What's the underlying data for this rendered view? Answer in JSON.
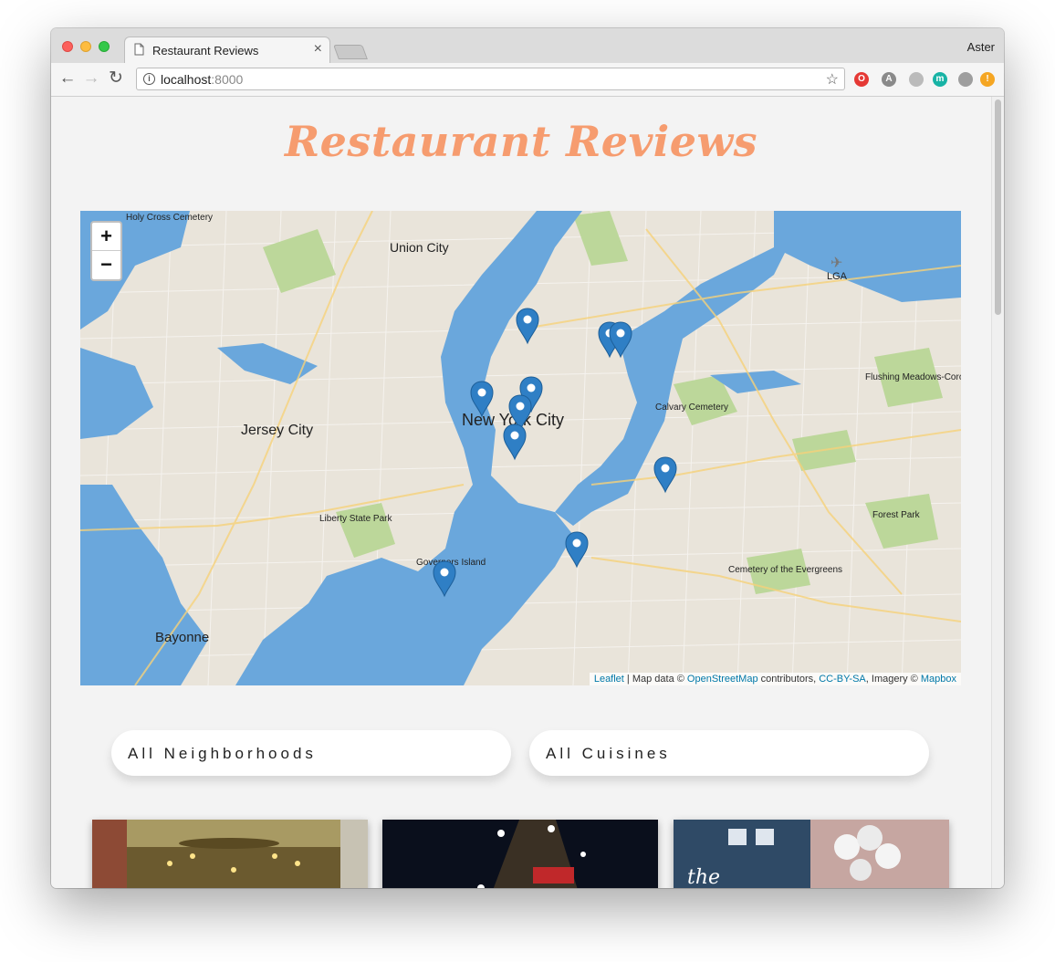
{
  "browser": {
    "tab_title": "Restaurant Reviews",
    "tab_close": "×",
    "profile_name": "Aster",
    "url_host": "localhost",
    "url_port": ":8000",
    "back_icon": "arrow-left-icon",
    "forward_icon": "arrow-right-icon",
    "reload_icon": "reload-icon",
    "star_icon": "star-icon",
    "extensions": [
      {
        "name": "opera-icon",
        "color": "#e53935",
        "glyph": "O"
      },
      {
        "name": "puzzle-icon",
        "color": "#8a8a8a",
        "glyph": "A"
      },
      {
        "name": "toggle-icon",
        "color": "#bbbbbb",
        "glyph": ""
      },
      {
        "name": "mixmax-icon",
        "color": "#18b3a5",
        "glyph": "m"
      },
      {
        "name": "shield-icon",
        "color": "#9e9e9e",
        "glyph": ""
      },
      {
        "name": "alert-icon",
        "color": "#f5a623",
        "glyph": "!"
      }
    ]
  },
  "page": {
    "title": "Restaurant Reviews",
    "map": {
      "zoom_in": "+",
      "zoom_out": "−",
      "labels": {
        "nyc": "New York City",
        "jersey": "Jersey City",
        "union": "Union City",
        "bayonne": "Bayonne",
        "holy_cross": "Holy Cross Cemetery",
        "lga": "LGA",
        "liberty": "Liberty State Park",
        "governors": "Governors Island",
        "calvary": "Calvary Cemetery",
        "forest_park": "Forest Park",
        "flushing": "Flushing Meadows-Corona Park",
        "evergreens": "Cemetery of the Evergreens"
      },
      "attribution": {
        "leaflet": "Leaflet",
        "sep1": " | Map data © ",
        "osm": "OpenStreetMap",
        "sep2": " contributors, ",
        "license": "CC-BY-SA",
        "sep3": ", Imagery © ",
        "mapbox": "Mapbox"
      },
      "markers": 10,
      "colors": {
        "water": "#6aa7dc",
        "land": "#e9e4da",
        "park": "#bcd79a",
        "marker": "#2f7fc5"
      }
    },
    "filters": {
      "neighborhoods": "All Neighborhoods",
      "cuisines": "All Cuisines"
    },
    "colors": {
      "title": "#f69c6f",
      "background": "#f3f3f3"
    }
  }
}
